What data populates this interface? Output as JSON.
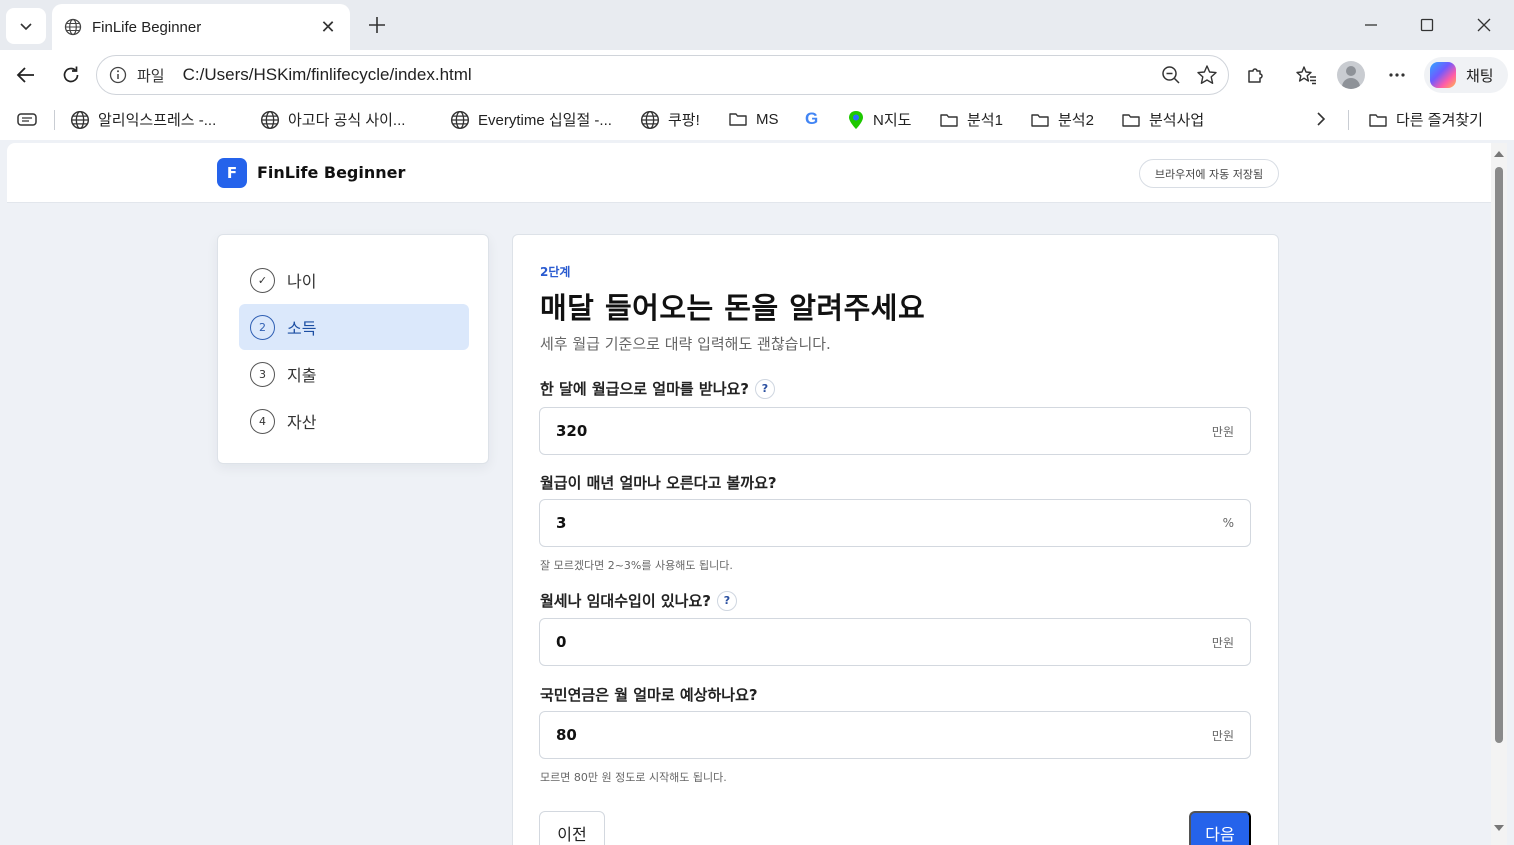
{
  "browser": {
    "tab_title": "FinLife Beginner",
    "omnibox_file_label": "파일",
    "omnibox_url": "C:/Users/HSKim/finlifecycle/index.html",
    "copilot_label": "채팅",
    "bookmarks": [
      {
        "label": "알리익스프레스 -...",
        "icon": "globe-icon"
      },
      {
        "label": "아고다 공식 사이...",
        "icon": "globe-icon"
      },
      {
        "label": "Everytime 십일절 -...",
        "icon": "globe-icon"
      },
      {
        "label": "쿠팡!",
        "icon": "globe-icon"
      },
      {
        "label": "MS",
        "icon": "folder-icon"
      },
      {
        "label": "G",
        "icon": "google-icon"
      },
      {
        "label": "N지도",
        "icon": "map-pin-icon"
      },
      {
        "label": "분석1",
        "icon": "folder-icon"
      },
      {
        "label": "분석2",
        "icon": "folder-icon"
      },
      {
        "label": "분석사업",
        "icon": "folder-icon"
      }
    ],
    "other_bookmarks_label": "다른 즐겨찾기"
  },
  "app": {
    "logo_letter": "F",
    "name": "FinLife Beginner",
    "autosave_label": "브라우저에 자동 저장됨"
  },
  "steps": [
    {
      "num": "✓",
      "label": "나이",
      "state": "done"
    },
    {
      "num": "2",
      "label": "소득",
      "state": "active"
    },
    {
      "num": "3",
      "label": "지출",
      "state": "todo"
    },
    {
      "num": "4",
      "label": "자산",
      "state": "todo"
    }
  ],
  "form": {
    "step_tag": "2단계",
    "title": "매달 들어오는 돈을 알려주세요",
    "subtitle": "세후 월급 기준으로 대략 입력해도 괜찮습니다.",
    "questions": [
      {
        "label": "한 달에 월급으로 얼마를 받나요?",
        "help": "?",
        "value": "320",
        "unit": "만원",
        "hint": ""
      },
      {
        "label": "월급이 매년 얼마나 오른다고 볼까요?",
        "help": "",
        "value": "3",
        "unit": "%",
        "hint": "잘 모르겠다면 2~3%를 사용해도 됩니다."
      },
      {
        "label": "월세나 임대수입이 있나요?",
        "help": "?",
        "value": "0",
        "unit": "만원",
        "hint": ""
      },
      {
        "label": "국민연금은 월 얼마로 예상하나요?",
        "help": "",
        "value": "80",
        "unit": "만원",
        "hint": "모르면 80만 원 정도로 시작해도 됩니다."
      }
    ],
    "prev_label": "이전",
    "next_label": "다음"
  },
  "colors": {
    "accent": "#2563eb",
    "active_step_bg": "#dbe8fb",
    "page_bg": "#eef1f6"
  }
}
